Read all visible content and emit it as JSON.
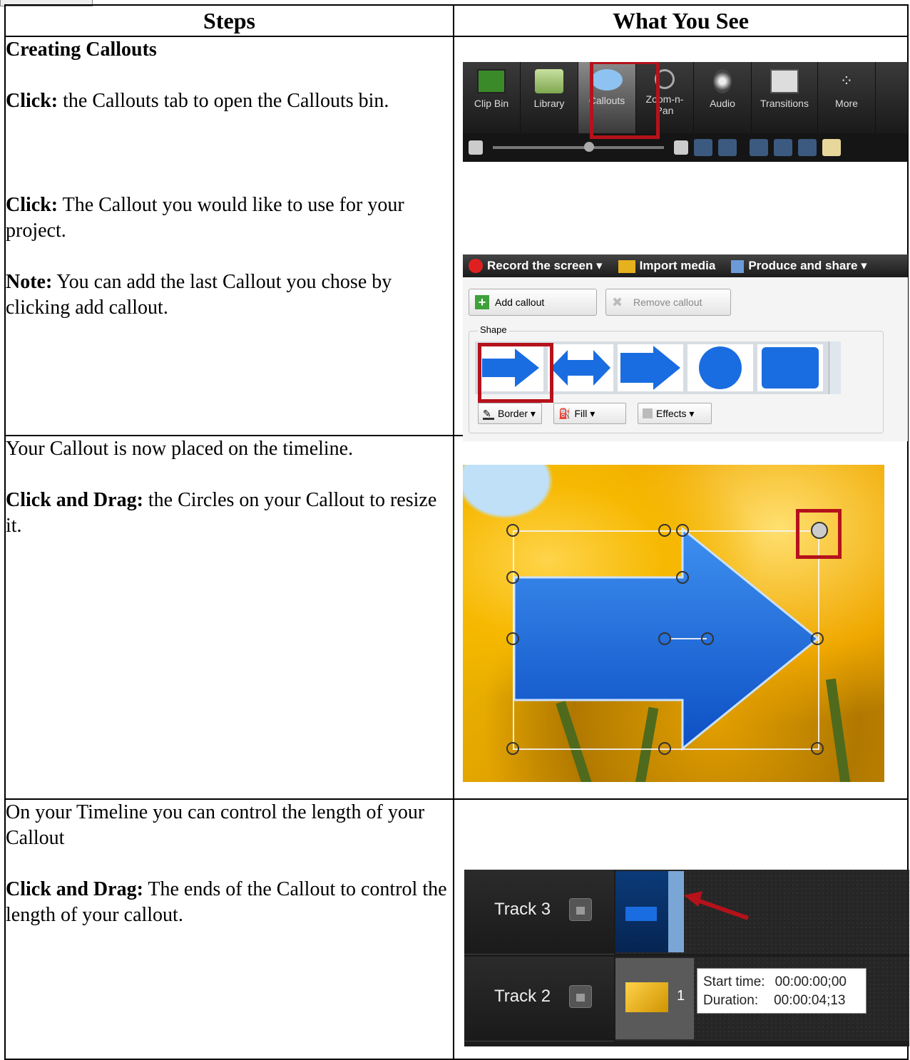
{
  "header": {
    "steps": "Steps",
    "see": "What You See"
  },
  "row1": {
    "title": "Creating Callouts",
    "p1_bold": "Click:",
    "p1_text": " the Callouts tab to open the Callouts bin.",
    "p2_bold": "Click:",
    "p2_text": " The Callout you would like to use for your project.",
    "p3_bold": "Note:",
    "p3_text": " You can add the last Callout you chose by clicking add callout."
  },
  "toolbar": {
    "tabs": [
      "Clip Bin",
      "Library",
      "Callouts",
      "Zoom-n-Pan",
      "Audio",
      "Transitions",
      "More"
    ],
    "zoom_label": "Zoom-n-",
    "zoom_label2": "Pan"
  },
  "recbar": {
    "record": "Record the screen ▾",
    "import": "Import media",
    "produce": "Produce and share ▾"
  },
  "panel": {
    "add": "Add callout",
    "remove": "Remove callout",
    "shape_legend": "Shape",
    "border": "Border ▾",
    "fill": "Fill ▾",
    "effects": "Effects ▾"
  },
  "row2": {
    "p1": "Your Callout is now placed on the timeline.",
    "p2_bold": "Click and Drag:",
    "p2_text": " the Circles on your Callout to resize it."
  },
  "row3": {
    "p1": "On your Timeline you can control the length of your Callout",
    "p2_bold": "Click and Drag:",
    "p2_text": " The ends of the Callout to control the length of your callout."
  },
  "timeline": {
    "track3": "Track 3",
    "track2": "Track 2",
    "clip2_num": "1",
    "start_label": "Start time:",
    "start_value": "00:00:00;00",
    "duration_label": "Duration:",
    "duration_value": "00:00:04;13"
  },
  "colors": {
    "highlight": "#b5121b",
    "callout_blue": "#1a6de0"
  }
}
